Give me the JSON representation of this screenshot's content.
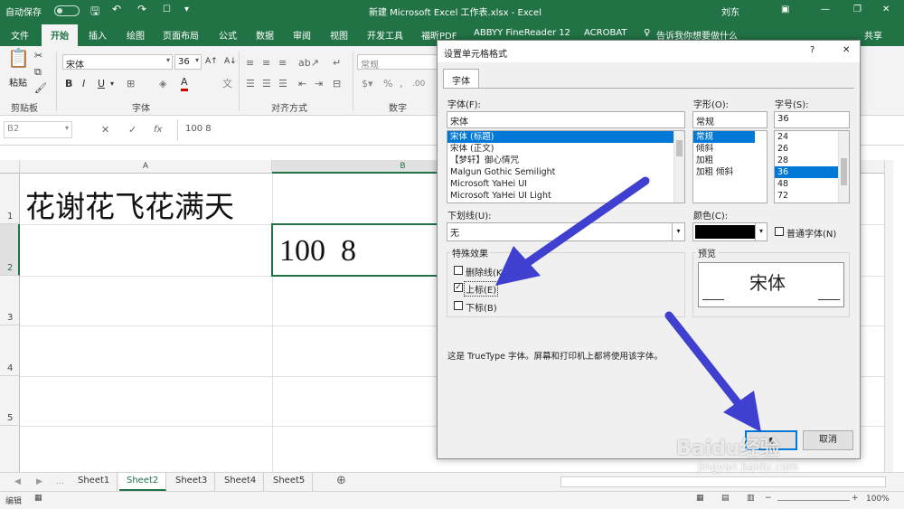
{
  "titlebar": {
    "autosave": "自动保存",
    "autosave_state": "off",
    "title": "新建 Microsoft Excel 工作表.xlsx  -  Excel",
    "user": "刘东"
  },
  "ribbon_tabs": [
    "文件",
    "开始",
    "插入",
    "绘图",
    "页面布局",
    "公式",
    "数据",
    "审阅",
    "视图",
    "开发工具",
    "福昕PDF",
    "ABBYY FineReader 12",
    "ACROBAT"
  ],
  "tell_me": "告诉我你想要做什么",
  "share": "共享",
  "ribbon": {
    "paste": "粘贴",
    "clipboard": "剪贴板",
    "font_name": "宋体",
    "font_size": "36",
    "bold": "B",
    "italic": "I",
    "underline": "U",
    "font_color_glyph": "A",
    "font_group": "字体",
    "align_group": "对齐方式",
    "number_format": "常规",
    "number_group": "数字"
  },
  "formula_bar": {
    "name_box": "B2",
    "fx": "fx",
    "content": "100 8"
  },
  "grid": {
    "columns": [
      "A",
      "B"
    ],
    "rows": [
      "1",
      "2",
      "3",
      "4",
      "5"
    ],
    "a1": "花谢花飞花满天",
    "b2": "100  8"
  },
  "sheets": [
    "Sheet1",
    "Sheet2",
    "Sheet3",
    "Sheet4",
    "Sheet5"
  ],
  "active_sheet": "Sheet2",
  "status": {
    "mode": "编辑",
    "zoom": "100%"
  },
  "dialog": {
    "title": "设置单元格格式",
    "tab": "字体",
    "help": "?",
    "close": "✕",
    "font_label": "字体(F):",
    "font_value": "宋体",
    "fonts": [
      "宋体 (标题)",
      "宋体 (正文)",
      "【梦轩】御心情咒",
      "Malgun Gothic Semilight",
      "Microsoft YaHei UI",
      "Microsoft YaHei UI Light"
    ],
    "font_selected_index": 0,
    "style_label": "字形(O):",
    "style_value": "常规",
    "styles": [
      "常规",
      "倾斜",
      "加粗",
      "加粗 倾斜"
    ],
    "style_selected_index": 0,
    "size_label": "字号(S):",
    "size_value": "36",
    "sizes": [
      "24",
      "26",
      "28",
      "36",
      "48",
      "72"
    ],
    "size_selected_index": 3,
    "underline_label": "下划线(U):",
    "underline_value": "无",
    "color_label": "颜色(C):",
    "color_value": "#000000",
    "normal_font_label": "普通字体(N)",
    "effects_label": "特殊效果",
    "strikethrough": "删除线(K)",
    "superscript": "上标(E)",
    "subscript": "下标(B)",
    "superscript_checked": true,
    "preview_label": "预览",
    "preview_text": "宋体",
    "info": "这是 TrueType 字体。屏幕和打印机上都将使用该字体。",
    "ok_glyph": "▮",
    "cancel_glyph": "取消"
  },
  "watermark": {
    "brand": "Baidu经验",
    "url": "jingyan.baidu.com"
  },
  "colors": {
    "excel_green": "#217346",
    "arrow": "#3f3fd0",
    "selection_blue": "#0078d7"
  }
}
